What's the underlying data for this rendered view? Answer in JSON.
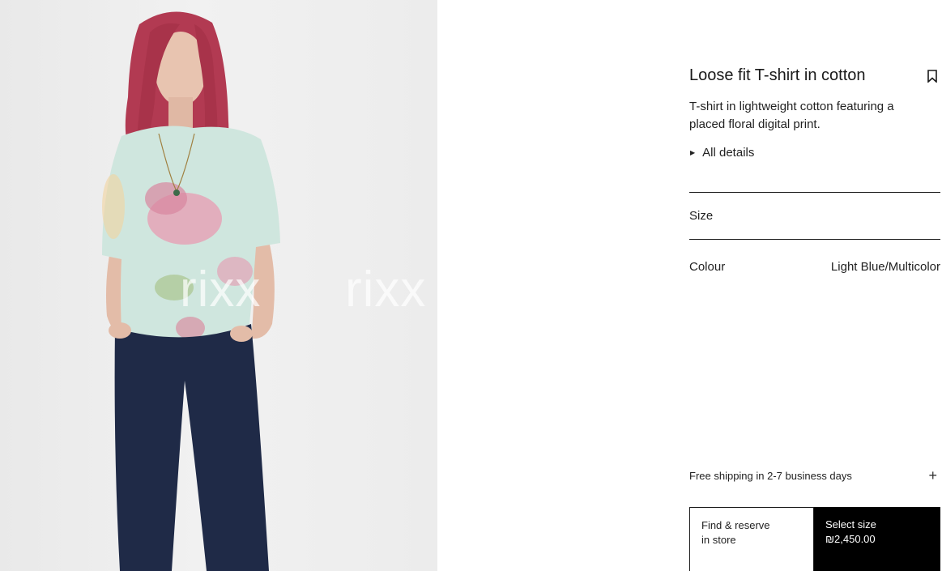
{
  "product": {
    "title": "Loose fit T-shirt in cotton",
    "description": "T-shirt in lightweight cotton featuring a placed floral digital print.",
    "all_details_label": "All details"
  },
  "size": {
    "label": "Size"
  },
  "colour": {
    "label": "Colour",
    "value": "Light Blue/Multicolor"
  },
  "shipping": {
    "label": "Free shipping in 2-7 business days"
  },
  "actions": {
    "find_line1": "Find & reserve",
    "find_line2": "in store",
    "select_line1": "Select size",
    "select_price": "₪2,450.00"
  },
  "watermark": {
    "text": "rixx"
  },
  "icons": {
    "bookmark": "bookmark-icon",
    "caret": "caret-right-icon",
    "plus": "plus-icon"
  },
  "colors": {
    "background": "#ffffff",
    "text": "#1a1a1a",
    "button_dark": "#000000",
    "photo_bg": "#ececec"
  }
}
